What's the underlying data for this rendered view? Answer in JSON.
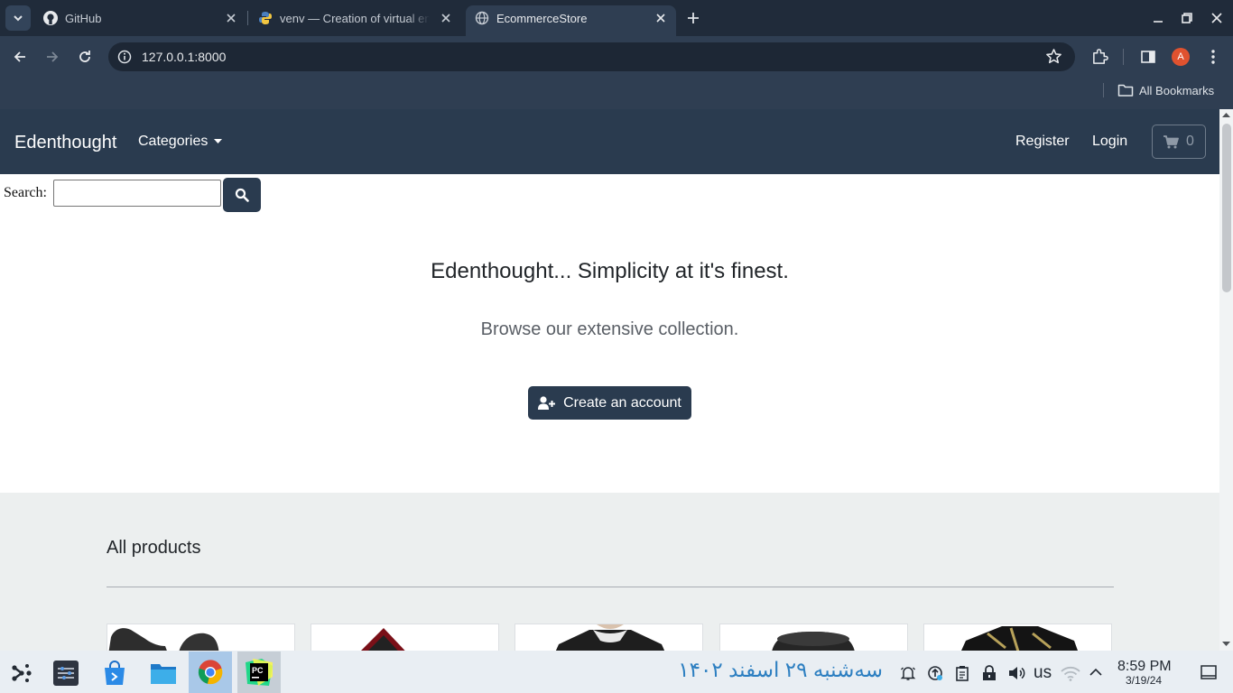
{
  "browser": {
    "tabs": [
      {
        "title": "GitHub"
      },
      {
        "title": "venv — Creation of virtual environments"
      },
      {
        "title": "EcommerceStore"
      }
    ],
    "address": "127.0.0.1:8000",
    "profile_initial": "A",
    "bookmarks_label": "All Bookmarks"
  },
  "site": {
    "brand": "Edenthought",
    "categories_label": "Categories",
    "register_label": "Register",
    "login_label": "Login",
    "cart_count": "0",
    "search_label": "Search:",
    "hero_title": "Edenthought... Simplicity at it's finest.",
    "hero_subtitle": "Browse our extensive collection.",
    "cta_label": "Create an account",
    "products_heading": "All products"
  },
  "taskbar": {
    "persian_date": "سه‌شنبه ۲۹ اسفند ۱۴۰۲",
    "keyboard_layout": "us",
    "time": "8:59 PM",
    "date": "3/19/24"
  },
  "colors": {
    "navbar": "#2a3b4f",
    "button": "#2a3b4f",
    "products_bg": "#ecefef",
    "chrome_dark": "#202b3a"
  }
}
